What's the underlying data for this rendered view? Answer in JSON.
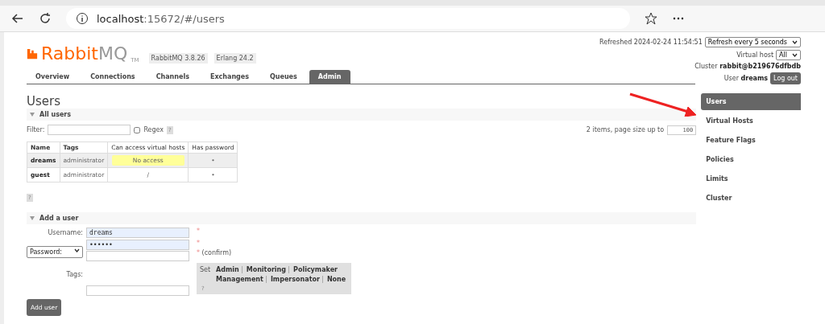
{
  "browser": {
    "url_host": "localhost",
    "url_rest": ":15672/#/users"
  },
  "header": {
    "logo_a": "Rabbit",
    "logo_b": "MQ",
    "logo_tm": "TM",
    "version": "RabbitMQ 3.8.26",
    "erlang": "Erlang 24.2",
    "refreshed": "Refreshed 2024-02-24 11:54:51",
    "refresh_option": "Refresh every 5 seconds",
    "vhost_label": "Virtual host",
    "vhost_option": "All",
    "cluster_label": "Cluster",
    "cluster": "rabbit@b219676dfbdb",
    "user_label": "User",
    "user": "dreams",
    "logout": "Log out"
  },
  "tabs": [
    {
      "label": "Overview",
      "selected": false
    },
    {
      "label": "Connections",
      "selected": false
    },
    {
      "label": "Channels",
      "selected": false
    },
    {
      "label": "Exchanges",
      "selected": false
    },
    {
      "label": "Queues",
      "selected": false
    },
    {
      "label": "Admin",
      "selected": true
    }
  ],
  "title": "Users",
  "all_users": {
    "heading": "All users",
    "filter_label": "Filter:",
    "regex_label": "Regex",
    "regex_checked": false,
    "help": "?",
    "paging": "2 items, page size up to",
    "page_size": "100",
    "columns": [
      "Name",
      "Tags",
      "Can access virtual hosts",
      "Has password"
    ],
    "rows": [
      {
        "name": "dreams",
        "tags": "administrator",
        "vhosts": "No access",
        "no_access": true,
        "password": "•"
      },
      {
        "name": "guest",
        "tags": "administrator",
        "vhosts": "/",
        "no_access": false,
        "password": "•"
      }
    ],
    "help_below": "?"
  },
  "add_user": {
    "heading": "Add a user",
    "username_label": "Username:",
    "username": "dreams",
    "password_mode": "Password:",
    "password": "••••••",
    "required": "*",
    "confirm": "(confirm)",
    "tags_label": "Tags:",
    "set_label": "Set",
    "tag_options": [
      "Admin",
      "Monitoring",
      "Policymaker",
      "Management",
      "Impersonator",
      "None"
    ],
    "help": "?",
    "submit": "Add user"
  },
  "sidebar": [
    {
      "label": "Users",
      "selected": true
    },
    {
      "label": "Virtual Hosts",
      "selected": false
    },
    {
      "label": "Feature Flags",
      "selected": false
    },
    {
      "label": "Policies",
      "selected": false
    },
    {
      "label": "Limits",
      "selected": false
    },
    {
      "label": "Cluster",
      "selected": false
    }
  ]
}
